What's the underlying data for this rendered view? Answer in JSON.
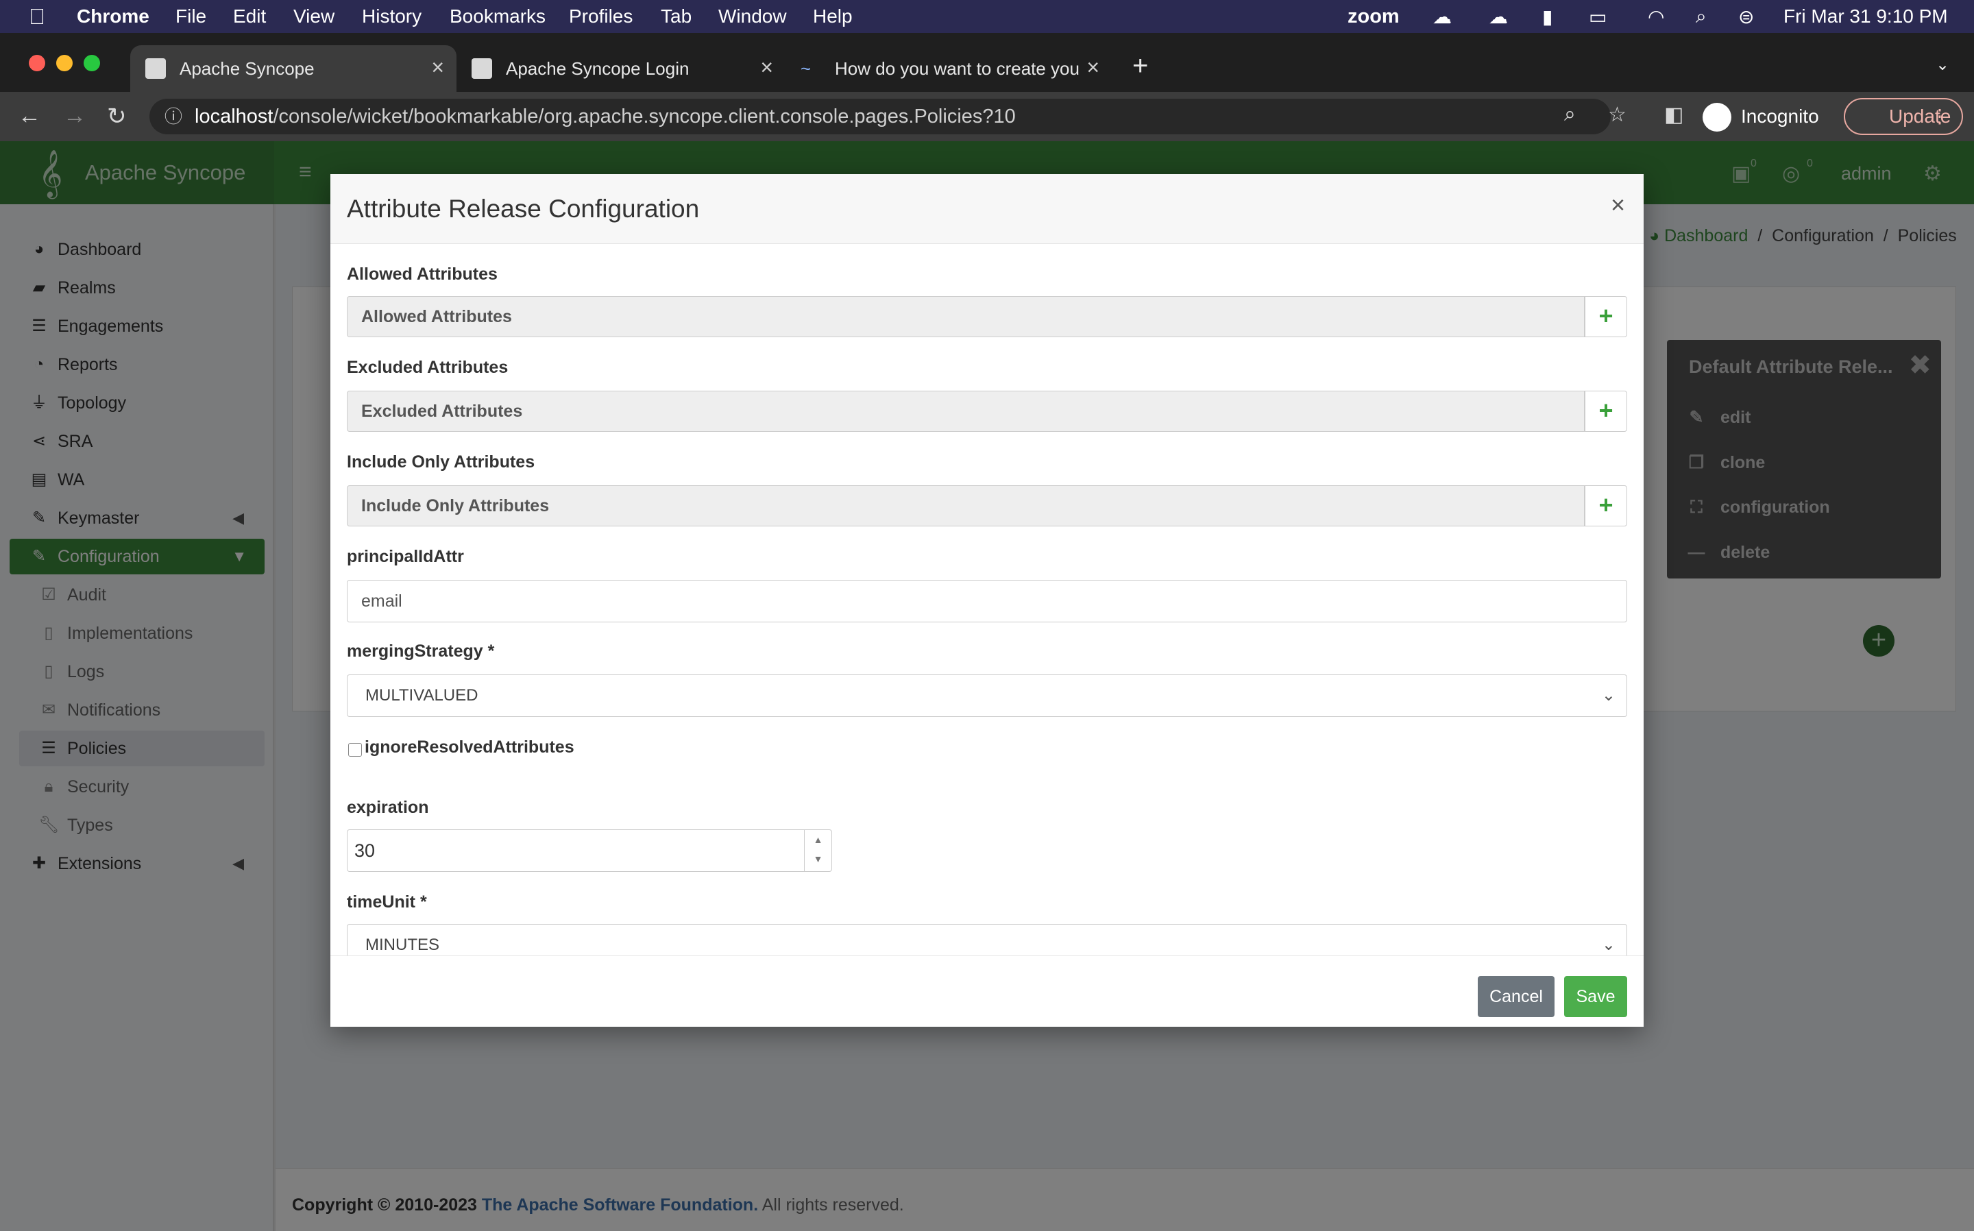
{
  "menubar": {
    "app": "Chrome",
    "items": [
      "File",
      "Edit",
      "View",
      "History",
      "Bookmarks",
      "Profiles",
      "Tab",
      "Window",
      "Help"
    ],
    "zoom": "zoom",
    "datetime": "Fri Mar 31  9:10 PM"
  },
  "browser": {
    "tabs": [
      {
        "title": "Apache Syncope"
      },
      {
        "title": "Apache Syncope Login"
      },
      {
        "title": "How do you want to create you"
      }
    ],
    "url_host": "localhost",
    "url_path": "/console/wicket/bookmarkable/org.apache.syncope.client.console.pages.Policies?10",
    "profile": "Incognito",
    "update_label": "Update"
  },
  "app": {
    "name": "Apache Syncope",
    "user": "admin",
    "badge_counts": [
      "0",
      "0"
    ]
  },
  "sidebar": {
    "items": [
      {
        "label": "Dashboard",
        "icon": "dashboard-icon"
      },
      {
        "label": "Realms",
        "icon": "folder-icon"
      },
      {
        "label": "Engagements",
        "icon": "list-icon"
      },
      {
        "label": "Reports",
        "icon": "pie-chart-icon"
      },
      {
        "label": "Topology",
        "icon": "plug-icon"
      },
      {
        "label": "SRA",
        "icon": "share-icon"
      },
      {
        "label": "WA",
        "icon": "id-card-icon"
      },
      {
        "label": "Keymaster",
        "icon": "wand-icon"
      },
      {
        "label": "Configuration",
        "icon": "edit-icon"
      }
    ],
    "config_children": [
      {
        "label": "Audit",
        "icon": "check-square-icon"
      },
      {
        "label": "Implementations",
        "icon": "file-code-icon"
      },
      {
        "label": "Logs",
        "icon": "file-icon"
      },
      {
        "label": "Notifications",
        "icon": "envelope-icon"
      },
      {
        "label": "Policies",
        "icon": "list-icon"
      },
      {
        "label": "Security",
        "icon": "lock-icon"
      },
      {
        "label": "Types",
        "icon": "wrench-icon"
      }
    ],
    "extensions": {
      "label": "Extensions",
      "icon": "puzzle-icon"
    }
  },
  "breadcrumb": {
    "items": [
      "Dashboard",
      "Configuration",
      "Policies"
    ],
    "sep": "/"
  },
  "context_menu": {
    "title": "Default Attribute Rele...",
    "items": [
      {
        "label": "edit",
        "icon": "pencil-icon"
      },
      {
        "label": "clone",
        "icon": "copy-icon"
      },
      {
        "label": "configuration",
        "icon": "expand-icon"
      },
      {
        "label": "delete",
        "icon": "minus-icon"
      }
    ]
  },
  "modal": {
    "title": "Attribute Release Configuration",
    "close": "×",
    "allowed_label": "Allowed Attributes",
    "allowed_placeholder": "Allowed Attributes",
    "excluded_label": "Excluded Attributes",
    "excluded_placeholder": "Excluded Attributes",
    "include_label": "Include Only Attributes",
    "include_placeholder": "Include Only Attributes",
    "principal_label": "principalIdAttr",
    "principal_value": "email",
    "merging_label": "mergingStrategy *",
    "merging_value": "MULTIVALUED",
    "ignore_label": "ignoreResolvedAttributes",
    "ignore_checked": false,
    "expiration_label": "expiration",
    "expiration_value": "30",
    "timeunit_label": "timeUnit *",
    "timeunit_value": "MINUTES",
    "cancel_label": "Cancel",
    "save_label": "Save",
    "plus": "+"
  },
  "footer": {
    "copyright": "Copyright © 2010-2023",
    "org": "The Apache Software Foundation.",
    "rights": "All rights reserved."
  },
  "colors": {
    "header_green": "#3d8b3d",
    "save_green": "#4cae4c",
    "cancel_gray": "#6c757d",
    "menubar": "#2b2a52"
  }
}
